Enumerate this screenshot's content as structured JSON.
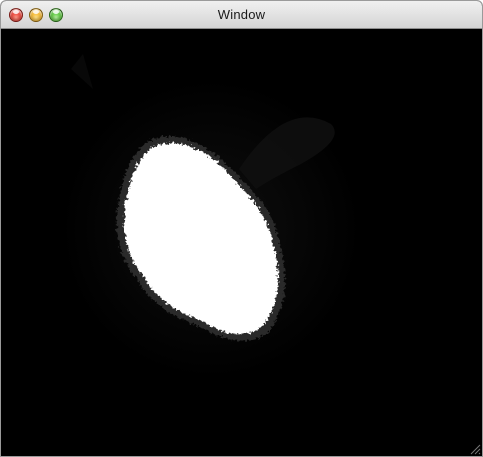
{
  "window": {
    "title": "Window"
  },
  "controls": {
    "close_icon": "close-circle",
    "minimize_icon": "minimize-circle",
    "zoom_icon": "zoom-circle",
    "close_color": "#e5332a",
    "minimize_color": "#f3b021",
    "zoom_color": "#4bbf2c"
  },
  "canvas": {
    "background_color": "#000000",
    "blob_color": "#ffffff"
  }
}
